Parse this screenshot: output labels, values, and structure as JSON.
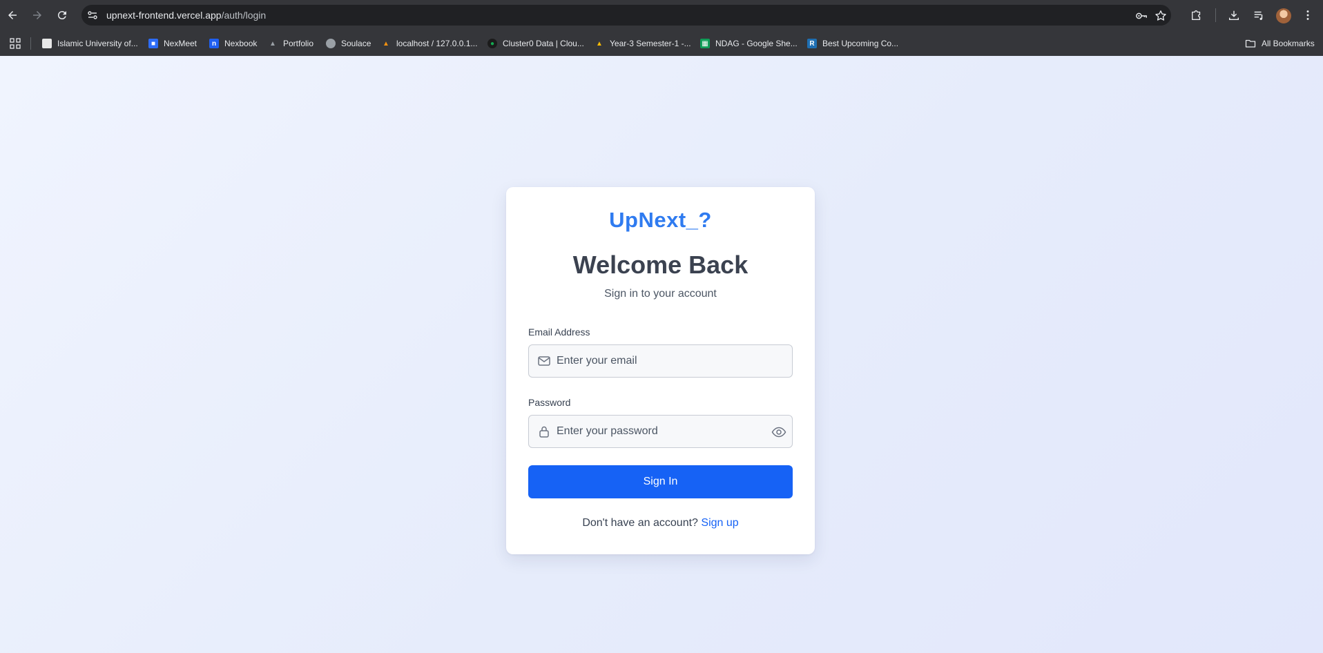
{
  "browser": {
    "url_host": "upnext-frontend.vercel.app",
    "url_path": "/auth/login",
    "bookmarks": [
      {
        "label": "Islamic University of...",
        "icon": "university-icon",
        "color": "#e8e8e8"
      },
      {
        "label": "NexMeet",
        "icon": "video-camera-icon",
        "color": "#2d6cf6"
      },
      {
        "label": "Nexbook",
        "icon": "n-logo-icon",
        "color": "#1f5ff0"
      },
      {
        "label": "Portfolio",
        "icon": "portfolio-icon",
        "color": "#9aa0a6"
      },
      {
        "label": "Soulace",
        "icon": "globe-icon",
        "color": "#9aa0a6"
      },
      {
        "label": "localhost / 127.0.0.1...",
        "icon": "phpmyadmin-icon",
        "color": "#f29111"
      },
      {
        "label": "Cluster0 Data | Clou...",
        "icon": "mongodb-leaf-icon",
        "color": "#13aa52"
      },
      {
        "label": "Year-3 Semester-1 -...",
        "icon": "google-drive-icon",
        "color": "#fbbc04"
      },
      {
        "label": "NDAG - Google She...",
        "icon": "google-sheets-icon",
        "color": "#0f9d58"
      },
      {
        "label": "Best Upcoming Co...",
        "icon": "r-logo-icon",
        "color": "#1f6fb2"
      }
    ],
    "all_bookmarks_label": "All Bookmarks"
  },
  "login": {
    "logo": "UpNext_?",
    "title": "Welcome Back",
    "subtitle": "Sign in to your account",
    "email_label": "Email Address",
    "email_placeholder": "Enter your email",
    "email_value": "",
    "password_label": "Password",
    "password_placeholder": "Enter your password",
    "password_value": "",
    "submit_label": "Sign In",
    "footer_text": "Don't have an account?",
    "signup_link": "Sign up"
  },
  "colors": {
    "accent": "#1662f5",
    "logo": "#2f7bf0",
    "background": "#eef2fb"
  }
}
